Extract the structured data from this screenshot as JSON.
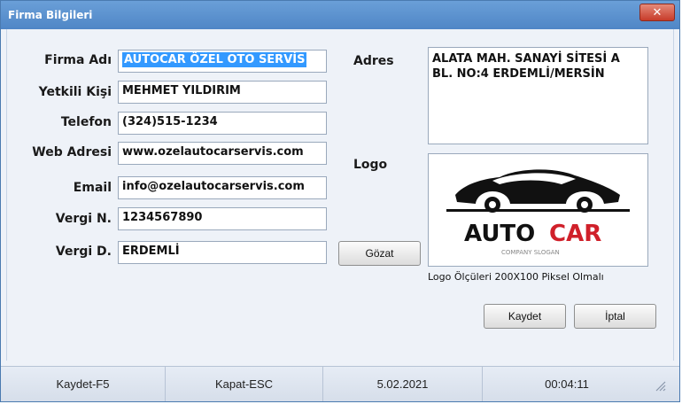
{
  "window": {
    "title": "Firma Bilgileri",
    "close_glyph": "✕"
  },
  "form": {
    "firma_adi": {
      "label": "Firma Adı",
      "value": "AUTOCAR ÖZEL OTO SERVİS"
    },
    "yetkili": {
      "label": "Yetkili Kişi",
      "value": "MEHMET YILDIRIM"
    },
    "telefon": {
      "label": "Telefon",
      "value": "(324)515-1234"
    },
    "web": {
      "label": "Web Adresi",
      "value": "www.ozelautocarservis.com"
    },
    "email": {
      "label": "Email",
      "value": "info@ozelautocarservis.com"
    },
    "vergi_no": {
      "label": "Vergi N.",
      "value": "1234567890"
    },
    "vergi_d": {
      "label": "Vergi D.",
      "value": "ERDEMLİ"
    },
    "adres": {
      "label": "Adres",
      "line1": "ALATA MAH. SANAYİ SİTESİ A",
      "line2": "BL. NO:4 ERDEMLİ/MERSİN"
    },
    "logo": {
      "label": "Logo",
      "brand_left": "AUTO",
      "brand_right": "CAR",
      "slogan": "COMPANY SLOGAN",
      "hint": "Logo Ölçüleri 200X100 Piksel Olmalı",
      "accent": "#d0202a"
    }
  },
  "buttons": {
    "browse": "Gözat",
    "save": "Kaydet",
    "cancel": "İptal"
  },
  "status": {
    "save_hotkey": "Kaydet-F5",
    "close_hotkey": "Kapat-ESC",
    "date": "5.02.2021",
    "time": "00:04:11"
  }
}
